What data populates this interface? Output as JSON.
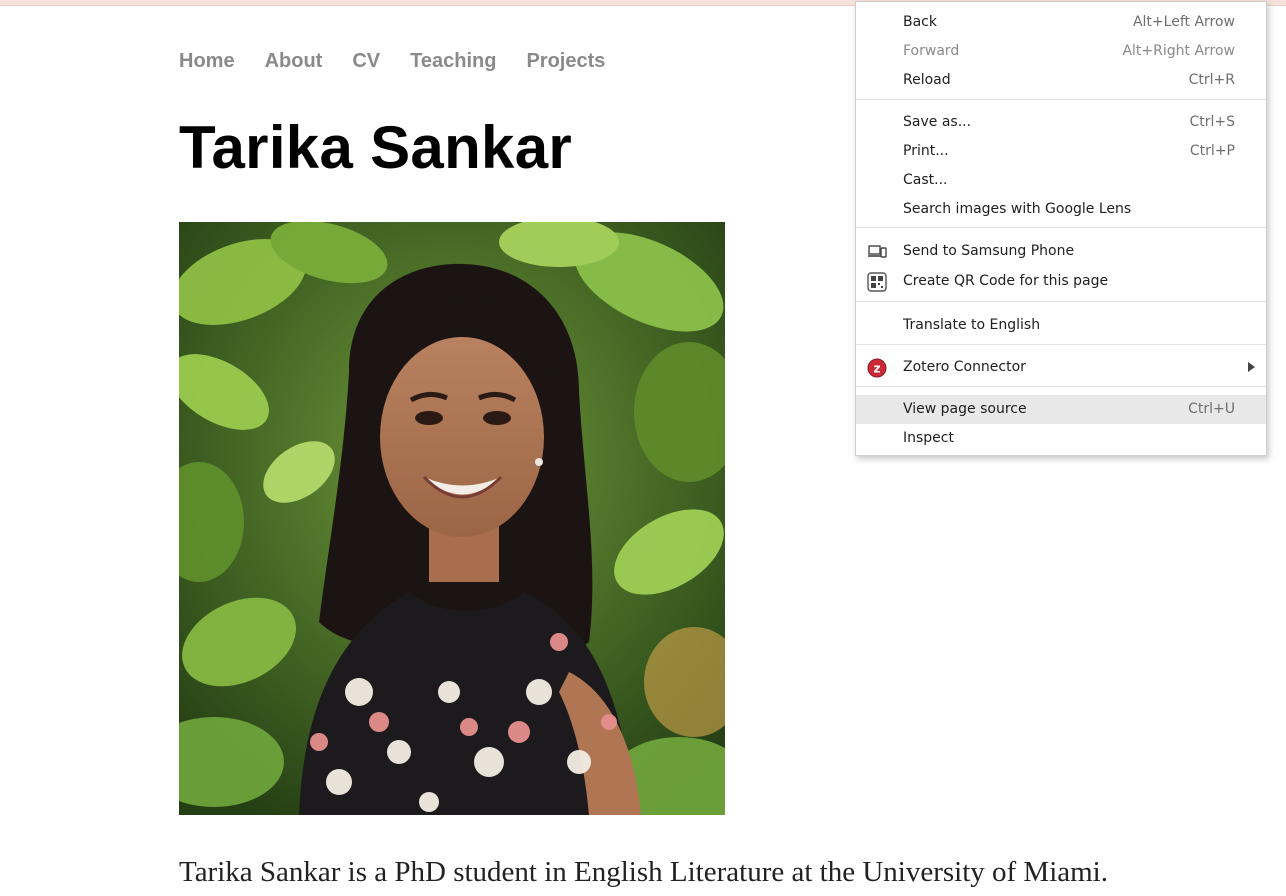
{
  "nav": {
    "items": [
      "Home",
      "About",
      "CV",
      "Teaching",
      "Projects"
    ]
  },
  "page": {
    "title": "Tarika Sankar",
    "bio": "Tarika Sankar is a PhD student in English Literature at the University of Miami."
  },
  "context_menu": {
    "back": {
      "label": "Back",
      "shortcut": "Alt+Left Arrow"
    },
    "forward": {
      "label": "Forward",
      "shortcut": "Alt+Right Arrow"
    },
    "reload": {
      "label": "Reload",
      "shortcut": "Ctrl+R"
    },
    "save_as": {
      "label": "Save as...",
      "shortcut": "Ctrl+S"
    },
    "print": {
      "label": "Print...",
      "shortcut": "Ctrl+P"
    },
    "cast": {
      "label": "Cast..."
    },
    "lens": {
      "label": "Search images with Google Lens"
    },
    "send_phone": {
      "label": "Send to Samsung Phone",
      "icon": "devices-icon"
    },
    "qr": {
      "label": "Create QR Code for this page",
      "icon": "qr-code-icon"
    },
    "translate": {
      "label": "Translate to English"
    },
    "zotero": {
      "label": "Zotero Connector",
      "icon": "zotero-icon",
      "has_submenu": true
    },
    "view_source": {
      "label": "View page source",
      "shortcut": "Ctrl+U",
      "highlighted": true
    },
    "inspect": {
      "label": "Inspect"
    }
  },
  "colors": {
    "nav_text": "#8a8a8a",
    "top_strip": "#f7e1dc",
    "menu_highlight": "#e8e8e8",
    "zotero_red": "#cc2936"
  }
}
